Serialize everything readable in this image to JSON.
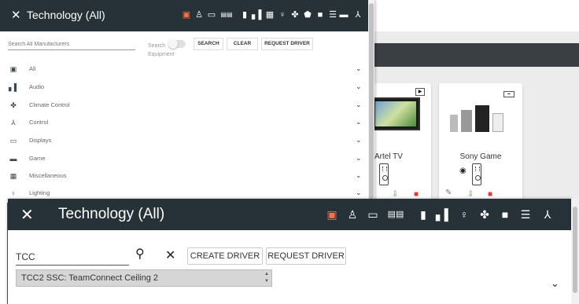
{
  "panel1": {
    "title": "Technology (All)",
    "close_icon": "close-icon",
    "header_icons": [
      "all-icon",
      "projector-icon",
      "displays-icon",
      "av-rack-icon",
      "film-icon",
      "audio-icon",
      "grid-icon",
      "lighting-icon",
      "climate-icon",
      "shield-icon",
      "camera-icon",
      "list-icon",
      "control-icon"
    ],
    "search_placeholder": "Search All Manufacturers",
    "search_equipment_label": "Search Equipment",
    "search_button": "SEARCH",
    "clear_button": "CLEAR",
    "request_driver_button": "REQUEST DRIVER",
    "categories": [
      {
        "label": "All",
        "icon": "all-icon"
      },
      {
        "label": "Audio",
        "icon": "audio-icon"
      },
      {
        "label": "Climate Control",
        "icon": "climate-icon"
      },
      {
        "label": "Control",
        "icon": "control-icon"
      },
      {
        "label": "Displays",
        "icon": "displays-icon"
      },
      {
        "label": "Game",
        "icon": "game-icon"
      },
      {
        "label": "Miscellaneous",
        "icon": "misc-icon"
      },
      {
        "label": "Lighting",
        "icon": "lighting-icon"
      }
    ]
  },
  "background": {
    "card1_name": "Artel TV",
    "card2_name": "Sony Game"
  },
  "panel2": {
    "title": "Technology (All)",
    "search_value": "TCC",
    "create_driver_button": "CREATE DRIVER",
    "request_driver_button": "REQUEST DRIVER",
    "suggestion": "TCC2 SSC: TeamConnect Ceiling 2"
  },
  "colors": {
    "header_bg": "#263238",
    "accent_orange": "#ff7043",
    "green": "#43a047",
    "red": "#e53935"
  }
}
